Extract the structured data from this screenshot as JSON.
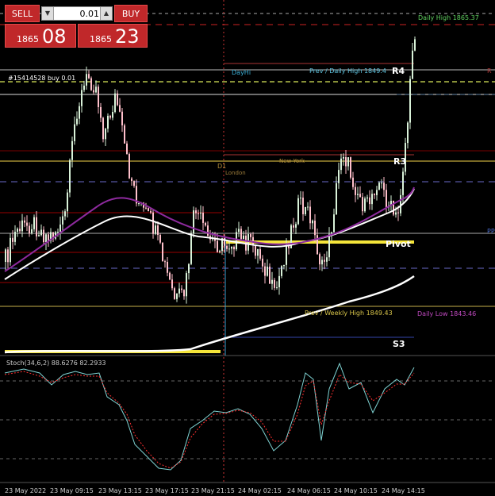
{
  "trade_panel": {
    "sell_label": "SELL",
    "buy_label": "BUY",
    "lot_value": "0.01",
    "bid_prefix": "1865",
    "bid_big": "08",
    "ask_prefix": "1865",
    "ask_big": "23"
  },
  "order_label": "#15414528 buy 0.01",
  "level_labels": {
    "dayhi": "DayHi",
    "prev_daily_high": "Prev / Daily High 1849.4",
    "daily_high": "Daily High 1865.37",
    "r4": "R4",
    "r3": "R3",
    "pivot": "Pivot",
    "s3": "S3",
    "prev_weekly_high": "Prev / Weekly High 1849.43",
    "daily_low": "Daily Low 1843.46",
    "new_york": "New York",
    "london": "London",
    "d1": "D1",
    "pp": "PP",
    "r": "R"
  },
  "stoch_label": "Stoch(34,6,2) 88.6276 82.2933",
  "time_labels": [
    "23 May 2022",
    "23 May 09:15",
    "23 May 13:15",
    "23 May 17:15",
    "23 May 21:15",
    "24 May 02:15",
    "24 May 06:15",
    "24 May 10:15",
    "24 May 14:15"
  ],
  "colors": {
    "bg": "#000000",
    "bull": "#d9f2d9",
    "bear": "#ffc0cb",
    "ma_white": "#ffffff",
    "ma_purple": "#8e2a9e",
    "pivot_yellow": "#f5e53a",
    "stoch_main": "#7fd3d3",
    "stoch_signal": "#ff3030"
  }
}
